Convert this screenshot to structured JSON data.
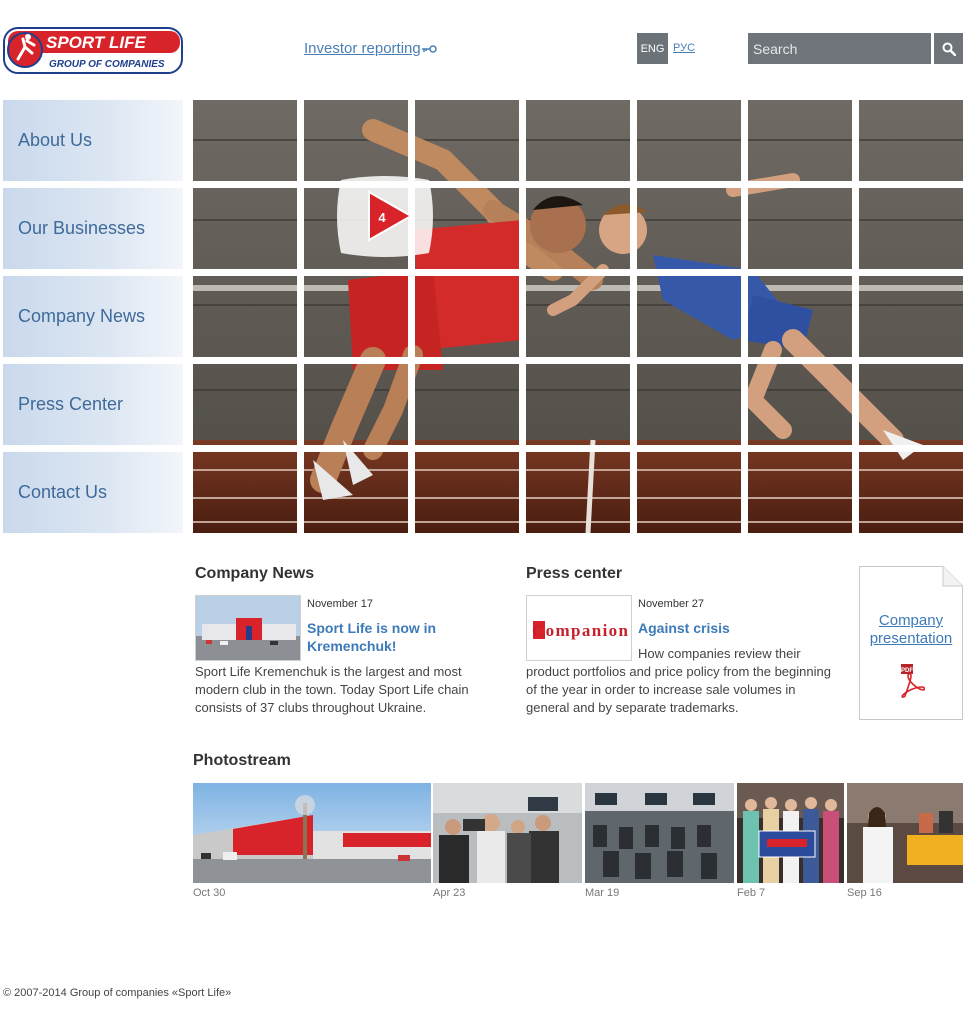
{
  "header": {
    "logo_text_top": "SPORT LIFE",
    "logo_text_bottom": "GROUP OF COMPANIES",
    "investor_link": "Investor reporting",
    "lang_eng": "ENG",
    "lang_rus": "РУС",
    "search_placeholder": "Search"
  },
  "nav": [
    {
      "label": "About Us"
    },
    {
      "label": "Our Businesses"
    },
    {
      "label": "Company News"
    },
    {
      "label": "Press Center"
    },
    {
      "label": "Contact Us"
    }
  ],
  "slider": {
    "play_count": "4"
  },
  "company_news": {
    "heading": "Company News",
    "date": "November 17",
    "link": "Sport Life is now in Kremenchuk!",
    "text": "Sport Life Kremenchuk is the largest and most modern club in the town. Today Sport Life chain consists of 37 clubs throughout Ukraine."
  },
  "press_center": {
    "heading": "Press center",
    "thumb_logo": "Companion",
    "date": "November 27",
    "link": "Against crisis",
    "text": "How companies review their product portfolios and price policy from the beginning of the year in order to increase sale volumes in general and by separate trademarks."
  },
  "presentation": {
    "title": "Company presentation",
    "badge": "PDF"
  },
  "photostream": {
    "heading": "Photostream",
    "items": [
      {
        "date": "Oct 30"
      },
      {
        "date": "Apr 23"
      },
      {
        "date": "Mar 19"
      },
      {
        "date": "Feb 7"
      },
      {
        "date": "Sep 16"
      }
    ]
  },
  "footer": {
    "text": "© 2007-2014 Group of companies «Sport Life»"
  },
  "colors": {
    "brand_red": "#d8232a",
    "brand_blue": "#1f3f8c",
    "link": "#3d7ab8",
    "nav_text": "#3f6a99"
  }
}
